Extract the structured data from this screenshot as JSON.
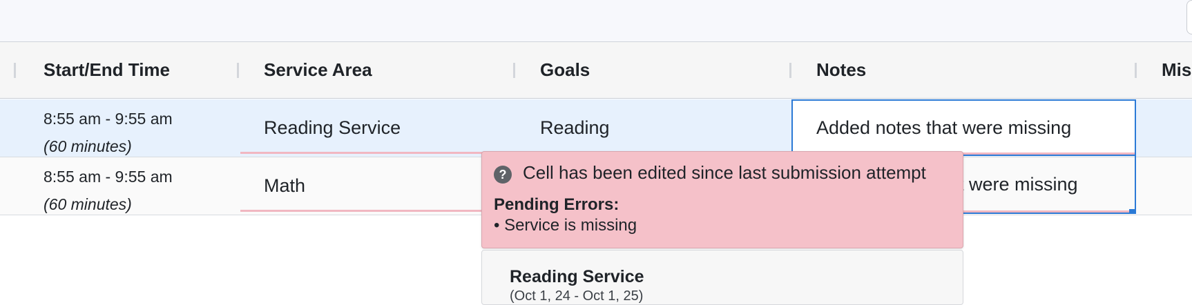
{
  "table": {
    "columns": [
      "Start/End Time",
      "Service Area",
      "Goals",
      "Notes",
      "Mis"
    ],
    "rows": [
      {
        "time": "8:55 am - 9:55 am",
        "duration": "(60 minutes)",
        "service_area": "Reading Service",
        "goals": "Reading",
        "notes": "Added notes that were missing"
      },
      {
        "time": "8:55 am - 9:55 am",
        "duration": "(60 minutes)",
        "service_area": "Math",
        "goals": "",
        "notes": "t were missing"
      }
    ]
  },
  "tooltip": {
    "icon": "question-icon",
    "message": "Cell has been edited since last submission attempt",
    "errors_title": "Pending Errors:",
    "errors": [
      "• Service is missing"
    ]
  },
  "dropdown": {
    "option_title": "Reading Service",
    "option_subtitle": "(Oct 1, 24 - Oct 1, 25)"
  },
  "colors": {
    "selected_row": "#e7f1fd",
    "active_border": "#2b7ad6",
    "error_tooltip": "#f5c1c9",
    "error_underline": "#f1b7c1"
  }
}
